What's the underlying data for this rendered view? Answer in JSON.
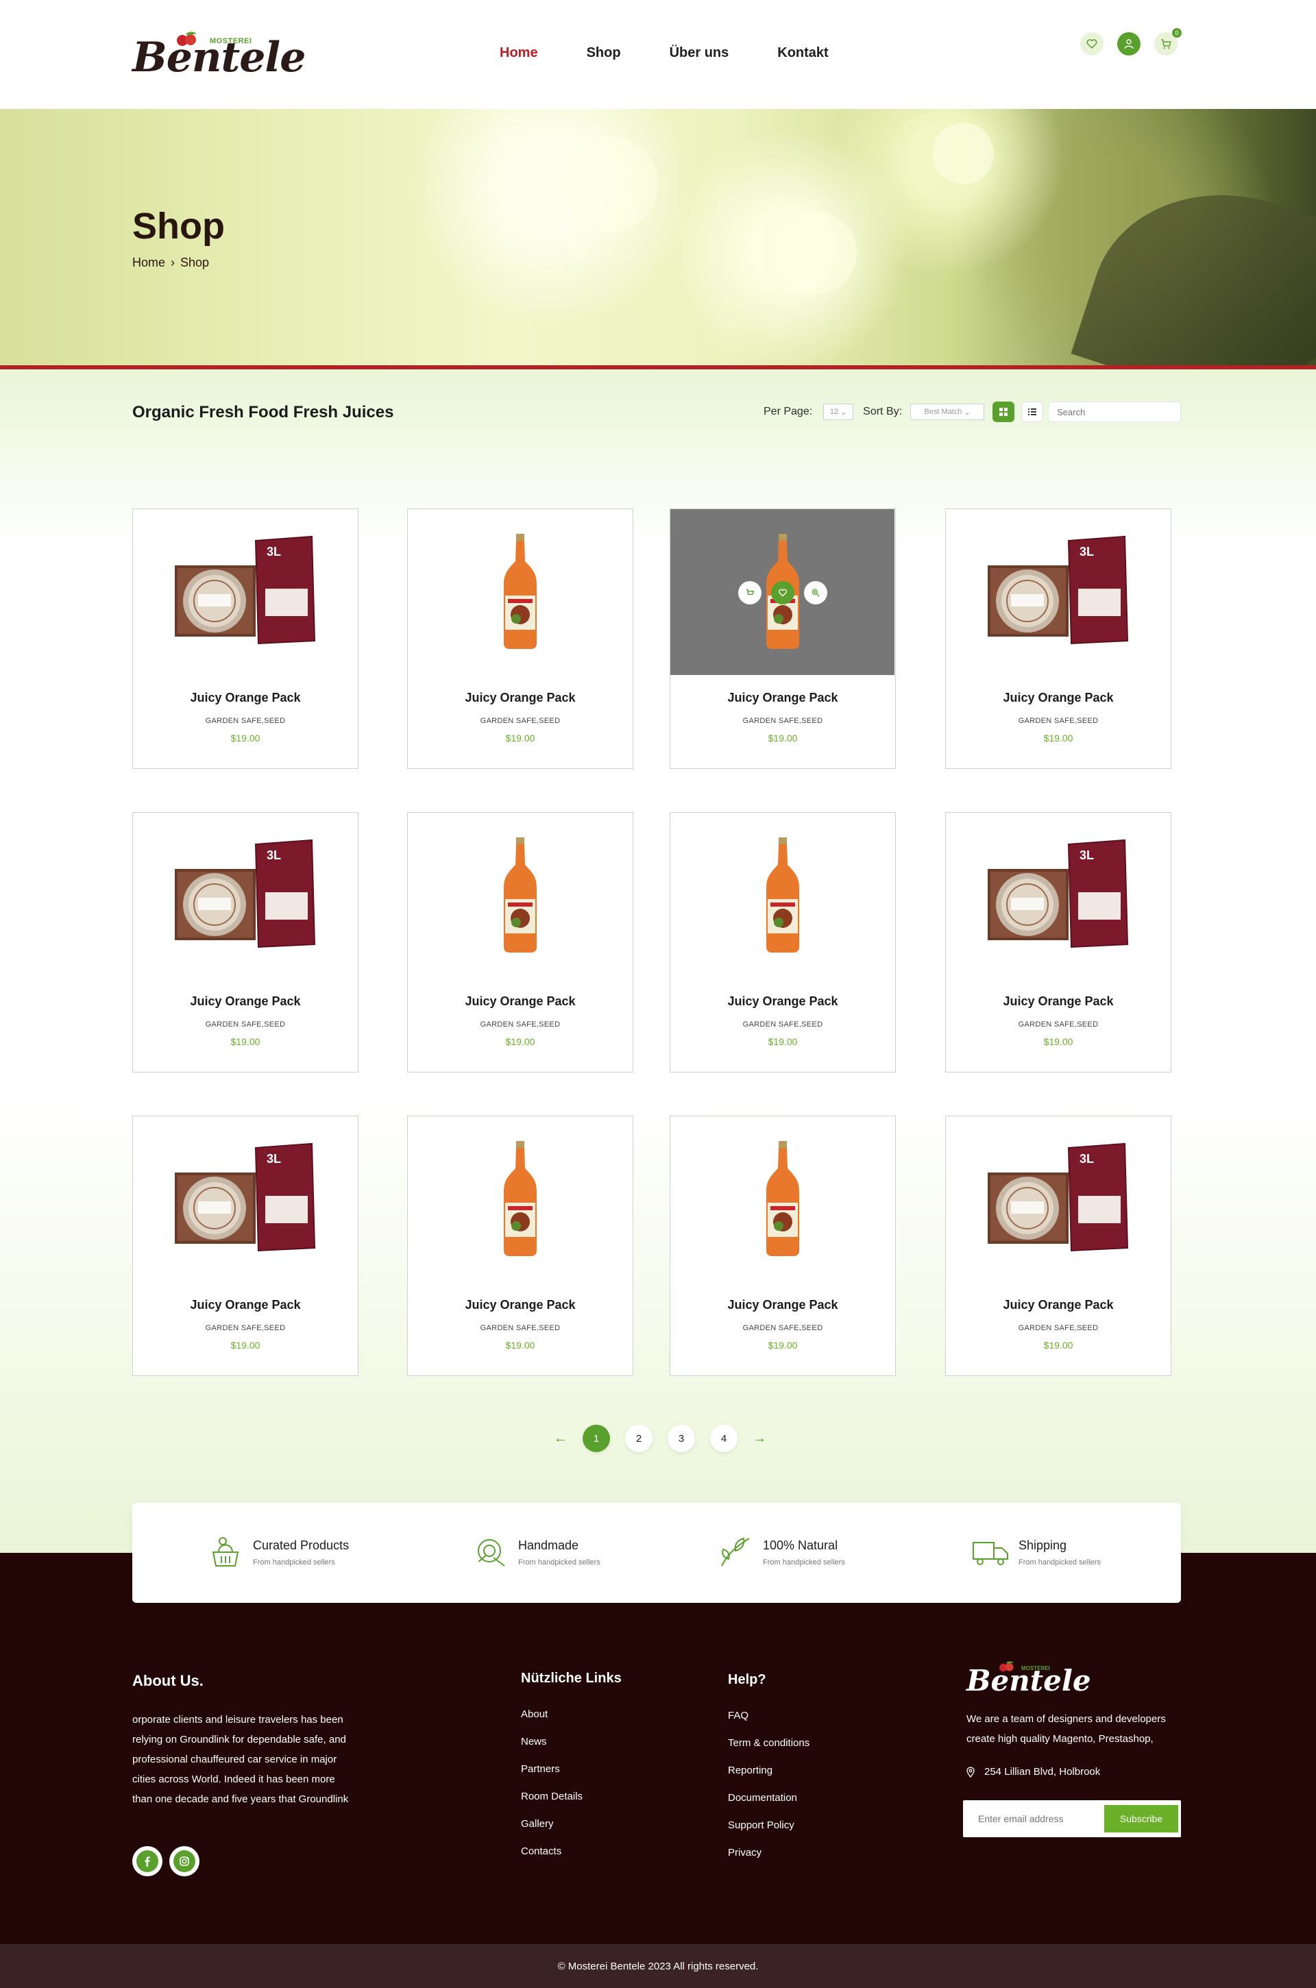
{
  "header": {
    "logo_word": "Bentele",
    "logo_sub": "MOSTEREI",
    "nav": [
      "Home",
      "Shop",
      "Über uns",
      "Kontakt"
    ],
    "cart_count": "0"
  },
  "hero": {
    "title": "Shop",
    "breadcrumb": [
      "Home",
      "Shop"
    ]
  },
  "toolbar": {
    "title": "Organic Fresh Food Fresh Juices",
    "per_page_label": "Per Page:",
    "per_page_value": "12",
    "sort_label": "Sort By:",
    "sort_value": "Best Match",
    "search_placeholder": "Search"
  },
  "products": [
    {
      "name": "Juicy Orange Pack",
      "category": "GARDEN SAFE,SEED",
      "price": "$19.00",
      "image": "box-pack"
    },
    {
      "name": "Juicy Orange Pack",
      "category": "GARDEN SAFE,SEED",
      "price": "$19.00",
      "image": "bottle"
    },
    {
      "name": "Juicy Orange Pack",
      "category": "GARDEN SAFE,SEED",
      "price": "$19.00",
      "image": "bottle"
    },
    {
      "name": "Juicy Orange Pack",
      "category": "GARDEN SAFE,SEED",
      "price": "$19.00",
      "image": "box-pack"
    },
    {
      "name": "Juicy Orange Pack",
      "category": "GARDEN SAFE,SEED",
      "price": "$19.00",
      "image": "box-pack"
    },
    {
      "name": "Juicy Orange Pack",
      "category": "GARDEN SAFE,SEED",
      "price": "$19.00",
      "image": "bottle"
    },
    {
      "name": "Juicy Orange Pack",
      "category": "GARDEN SAFE,SEED",
      "price": "$19.00",
      "image": "bottle"
    },
    {
      "name": "Juicy Orange Pack",
      "category": "GARDEN SAFE,SEED",
      "price": "$19.00",
      "image": "box-pack"
    },
    {
      "name": "Juicy Orange Pack",
      "category": "GARDEN SAFE,SEED",
      "price": "$19.00",
      "image": "box-pack"
    },
    {
      "name": "Juicy Orange Pack",
      "category": "GARDEN SAFE,SEED",
      "price": "$19.00",
      "image": "bottle"
    },
    {
      "name": "Juicy Orange Pack",
      "category": "GARDEN SAFE,SEED",
      "price": "$19.00",
      "image": "bottle"
    },
    {
      "name": "Juicy Orange Pack",
      "category": "GARDEN SAFE,SEED",
      "price": "$19.00",
      "image": "box-pack"
    }
  ],
  "box_label": "3L",
  "pagination": [
    "1",
    "2",
    "3",
    "4"
  ],
  "features": [
    {
      "title": "Curated Products",
      "sub": "From handpicked sellers",
      "icon": "basket-icon"
    },
    {
      "title": "Handmade",
      "sub": "From handpicked sellers",
      "icon": "handmade-icon"
    },
    {
      "title": "100% Natural",
      "sub": "From handpicked sellers",
      "icon": "leaf-icon"
    },
    {
      "title": "Shipping",
      "sub": "From handpicked sellers",
      "icon": "truck-icon"
    }
  ],
  "footer": {
    "about_title": "About Us.",
    "about_text": "orporate clients and leisure travelers has been relying on Groundlink for dependable safe, and professional chauffeured car service in major cities across World. Indeed it has been more than one decade and five years that Groundlink",
    "links_title": "Nützliche Links",
    "links": [
      "About",
      "News",
      "Partners",
      "Room Details",
      "Gallery",
      "Contacts"
    ],
    "help_title": "Help?",
    "help": [
      "FAQ",
      "Term & conditions",
      "Reporting",
      "Documentation",
      "Support Policy",
      "Privacy"
    ],
    "logo_word": "Bentele",
    "logo_sub": "MOSTEREI",
    "desc": "We are a team of designers and developers create high quality Magento, Prestashop,",
    "address": "254 Lillian Blvd, Holbrook",
    "email_placeholder": "Enter email address",
    "subscribe_label": "Subscribe",
    "copyright": "©  Mosterei Bentele 2023 All rights reserved."
  },
  "colors": {
    "brand_red": "#b52025",
    "brand_green": "#5aa02c",
    "footer_bg": "#230707"
  }
}
